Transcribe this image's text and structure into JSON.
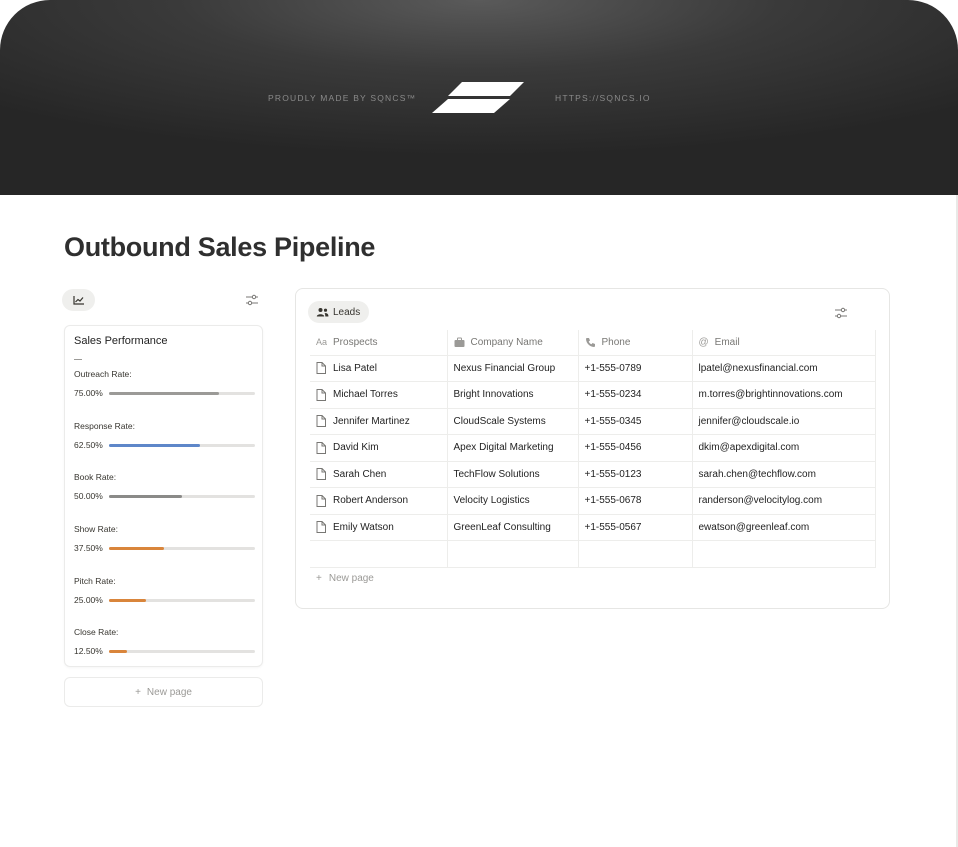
{
  "banner": {
    "made_by": "PROUDLY MADE BY SQNCS™",
    "url": "HTTPS://SQNCS.IO"
  },
  "page": {
    "title": "Outbound Sales Pipeline"
  },
  "performance": {
    "card_title": "Sales Performance",
    "metrics": [
      {
        "label": "Outreach Rate:",
        "value": "75.00%",
        "fraction": 0.75,
        "color": "#9b9a97"
      },
      {
        "label": "Response Rate:",
        "value": "62.50%",
        "fraction": 0.625,
        "color": "#5e87c9"
      },
      {
        "label": "Book Rate:",
        "value": "50.00%",
        "fraction": 0.5,
        "color": "#8a8a88"
      },
      {
        "label": "Show Rate:",
        "value": "37.50%",
        "fraction": 0.375,
        "color": "#d9853b"
      },
      {
        "label": "Pitch Rate:",
        "value": "25.00%",
        "fraction": 0.25,
        "color": "#d9853b"
      },
      {
        "label": "Close Rate:",
        "value": "12.50%",
        "fraction": 0.125,
        "color": "#d9853b"
      }
    ],
    "new_page": "New page"
  },
  "leads": {
    "tab_label": "Leads",
    "columns": [
      "Prospects",
      "Company Name",
      "Phone",
      "Email"
    ],
    "rows": [
      [
        "Lisa Patel",
        "Nexus Financial Group",
        "+1-555-0789",
        "lpatel@nexusfinancial.com"
      ],
      [
        "Michael Torres",
        "Bright Innovations",
        "+1-555-0234",
        "m.torres@brightinnovations.com"
      ],
      [
        "Jennifer Martinez",
        "CloudScale Systems",
        "+1-555-0345",
        "jennifer@cloudscale.io"
      ],
      [
        "David Kim",
        "Apex Digital Marketing",
        "+1-555-0456",
        "dkim@apexdigital.com"
      ],
      [
        "Sarah Chen",
        "TechFlow Solutions",
        "+1-555-0123",
        "sarah.chen@techflow.com"
      ],
      [
        "Robert Anderson",
        "Velocity Logistics",
        "+1-555-0678",
        "randerson@velocitylog.com"
      ],
      [
        "Emily Watson",
        "GreenLeaf Consulting",
        "+1-555-0567",
        "ewatson@greenleaf.com"
      ]
    ],
    "new_page": "New page"
  }
}
